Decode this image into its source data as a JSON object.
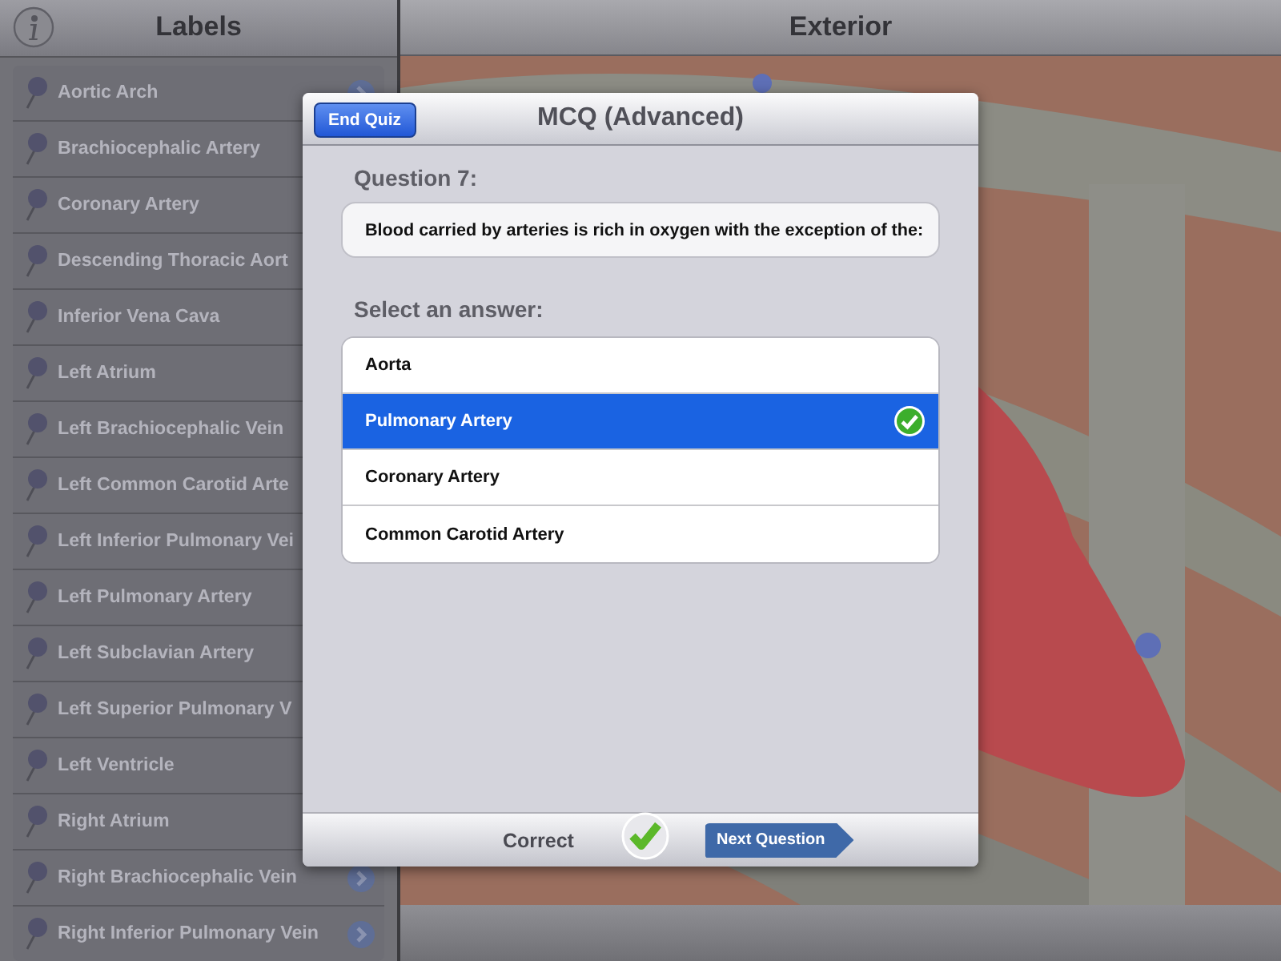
{
  "labels_panel": {
    "title": "Labels",
    "items": [
      {
        "label": "Aortic Arch",
        "disclosure": true
      },
      {
        "label": "Brachiocephalic Artery",
        "disclosure": false
      },
      {
        "label": "Coronary Artery",
        "disclosure": false
      },
      {
        "label": "Descending Thoracic Aort",
        "disclosure": false
      },
      {
        "label": "Inferior Vena Cava",
        "disclosure": false
      },
      {
        "label": "Left Atrium",
        "disclosure": false
      },
      {
        "label": "Left Brachiocephalic Vein",
        "disclosure": false
      },
      {
        "label": "Left Common Carotid Arte",
        "disclosure": false
      },
      {
        "label": "Left Inferior Pulmonary Vei",
        "disclosure": false
      },
      {
        "label": "Left Pulmonary Artery",
        "disclosure": false
      },
      {
        "label": "Left Subclavian Artery",
        "disclosure": false
      },
      {
        "label": "Left Superior Pulmonary V",
        "disclosure": false
      },
      {
        "label": "Left Ventricle",
        "disclosure": false
      },
      {
        "label": "Right Atrium",
        "disclosure": false
      },
      {
        "label": "Right Brachiocephalic Vein",
        "disclosure": true
      },
      {
        "label": "Right Inferior Pulmonary Vein",
        "disclosure": true
      }
    ]
  },
  "view_panel": {
    "title": "Exterior"
  },
  "quiz": {
    "end_button": "End Quiz",
    "title": "MCQ (Advanced)",
    "question_label": "Question 7:",
    "question": "Blood carried by arteries is rich in oxygen with the exception of the:",
    "answers_label": "Select an answer:",
    "answers": [
      {
        "text": "Aorta",
        "selected": false
      },
      {
        "text": "Pulmonary Artery",
        "selected": true
      },
      {
        "text": "Coronary Artery",
        "selected": false
      },
      {
        "text": "Common Carotid Artery",
        "selected": false
      }
    ],
    "result": "Correct",
    "correct": true,
    "next_button": "Next Question"
  }
}
